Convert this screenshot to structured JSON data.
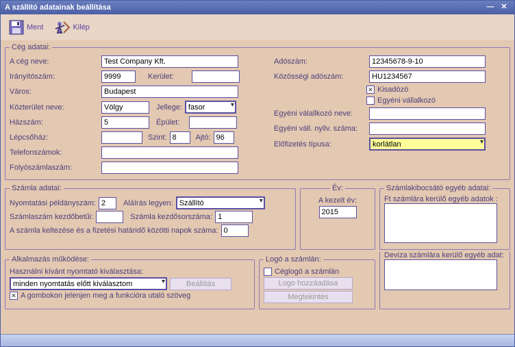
{
  "window": {
    "title": "A szállító adatainak beállítása"
  },
  "toolbar": {
    "save": "Ment",
    "exit": "Kilép"
  },
  "company": {
    "legend": "Cég adatai:",
    "name_label": "A cég neve:",
    "name": "Test Company Kft.",
    "zip_label": "Irányítószám:",
    "zip": "9999",
    "district_label": "Kerület:",
    "district": "",
    "city_label": "Város:",
    "city": "Budapest",
    "street_label": "Közterület neve:",
    "street": "Völgy",
    "streettype_label": "Jellege:",
    "streettype": "fasor",
    "houseno_label": "Házszám:",
    "houseno": "5",
    "building_label": "Épület:",
    "building": "",
    "stair_label": "Lépcsőház:",
    "stair": "",
    "floor_label": "Szint:",
    "floor": "8",
    "door_label": "Ajtó:",
    "door": "96",
    "phones_label": "Telefonszámok:",
    "phones": "",
    "bank_label": "Folyószámlaszám:",
    "bank": "",
    "tax_label": "Adószám:",
    "tax": "12345678-9-10",
    "eu_label": "Közösségi adószám:",
    "eu": "HU1234567",
    "kisado_label": "Kisadózó",
    "kisado_checked": true,
    "egyeni_label": "Egyéni vállalkozó",
    "egyeni_checked": false,
    "ev_name_label": "Egyéni válallkozó neve:",
    "ev_name": "",
    "ev_reg_label": "Egyéni váll. nyilv. száma:",
    "ev_reg": "",
    "sub_label": "Előfizetés típusa:",
    "sub": "korlátlan"
  },
  "invoice": {
    "legend": "Számla adatai:",
    "copies_label": "Nyomtatási példányszám:",
    "copies": "2",
    "sign_label": "Aláírás legyen:",
    "sign": "Szállító",
    "prefix_label": "Számlaszám kezdőbetűi:",
    "prefix": "",
    "startno_label": "Számla kezdősorszáma:",
    "startno": "1",
    "days_label": "A számla keltezése és a fizetési határidő közötti napok száma:",
    "days": "0"
  },
  "year": {
    "legend": "Év:",
    "label": "A kezelt év:",
    "value": "2015"
  },
  "issuer": {
    "legend": "Számlakibocsátó egyéb adatai:",
    "ft_label": "Ft számlára kerülő egyéb adatok :",
    "ft": "",
    "deviza_label": "Deviza számlára kerülő egyéb adat:",
    "deviza": ""
  },
  "app": {
    "legend": "Alkalmazás működése:",
    "printer_label": "Használni kívánt nyomtató kiválasztása:",
    "printer": "minden nyomtatás előtt kiválasztom",
    "set_btn": "Beállítás",
    "hint_label": "A gombokon jelenjen meg a funkcióra utaló szöveg",
    "hint_checked": true
  },
  "logo": {
    "legend": "Logó a számlán:",
    "chk_label": "Céglogó a számlán",
    "chk": false,
    "add_btn": "Logo hozzáadása",
    "view_btn": "Megtekintés"
  }
}
